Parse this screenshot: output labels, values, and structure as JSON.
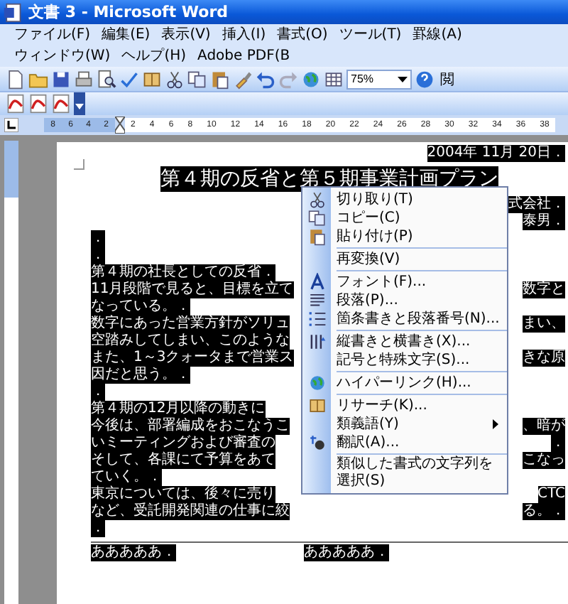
{
  "window": {
    "title": "文書 3 - Microsoft Word"
  },
  "menu_bar": [
    "ファイル(F)",
    "編集(E)",
    "表示(V)",
    "挿入(I)",
    "書式(O)",
    "ツール(T)",
    "罫線(A)",
    "ウィンドウ(W)",
    "ヘルプ(H)",
    "Adobe PDF(B"
  ],
  "toolbar": {
    "zoom": "75%",
    "reading_button": "閲"
  },
  "ruler": {
    "left_ticks": [
      "8",
      "6",
      "4",
      "2"
    ],
    "right_ticks": [
      "2",
      "4",
      "6",
      "8",
      "10",
      "12",
      "14",
      "16",
      "18",
      "20",
      "22",
      "24",
      "26",
      "28",
      "30",
      "32",
      "34",
      "36",
      "38"
    ]
  },
  "document": {
    "date": "2004年 11月 20日．",
    "title": "第４期の反省と第５期事業計画プラン",
    "lines": [
      {
        "right": "式会社．"
      },
      {
        "right": "泰男．"
      },
      {
        "left": "．"
      },
      {
        "left": "．"
      },
      {
        "left": "第４期の社長としての反省．"
      },
      {
        "left": "11月段階で見ると、目標を立て",
        "right": "数字と"
      },
      {
        "left": "なっている。．"
      },
      {
        "left": "数字にあった営業方針がソリュ",
        "right": "まい、"
      },
      {
        "left": "空踏みしてしまい、このような"
      },
      {
        "left": "また、1～3クォータまで営業ス",
        "right": "きな原"
      },
      {
        "left": "因だと思う。．"
      },
      {
        "left": "．"
      },
      {
        "left": "第４期の12月以降の動きに"
      },
      {
        "left": "今後は、部署編成をおこなうこ",
        "right": "、暗が"
      },
      {
        "left": "いミーティングおよび審査の",
        "right": "．"
      },
      {
        "left": "そして、各課にて予算をあて",
        "right": "こなっ"
      },
      {
        "left": "ていく。．"
      },
      {
        "left": "東京については、後々に売り",
        "right": "CTC"
      },
      {
        "left": "など、受託開発関連の仕事に絞",
        "right": "る。．"
      },
      {
        "left": "．"
      }
    ],
    "table_row": [
      "あああああ．",
      "あああああ．"
    ]
  },
  "context_menu": {
    "items": [
      {
        "kind": "item",
        "label": "切り取り(T)",
        "submenu": false
      },
      {
        "kind": "item",
        "label": "コピー(C)",
        "submenu": false
      },
      {
        "kind": "item",
        "label": "貼り付け(P)",
        "submenu": false
      },
      {
        "kind": "separator"
      },
      {
        "kind": "item",
        "label": "再変換(V)",
        "submenu": false
      },
      {
        "kind": "separator"
      },
      {
        "kind": "item",
        "label": "フォント(F)...",
        "submenu": false
      },
      {
        "kind": "item",
        "label": "段落(P)...",
        "submenu": false
      },
      {
        "kind": "item",
        "label": "箇条書きと段落番号(N)...",
        "submenu": false
      },
      {
        "kind": "separator"
      },
      {
        "kind": "item",
        "label": "縦書きと横書き(X)...",
        "submenu": false
      },
      {
        "kind": "item",
        "label": "記号と特殊文字(S)...",
        "submenu": false
      },
      {
        "kind": "separator"
      },
      {
        "kind": "item",
        "label": "ハイパーリンク(H)...",
        "submenu": false
      },
      {
        "kind": "separator"
      },
      {
        "kind": "item",
        "label": "リサーチ(K)...",
        "submenu": false
      },
      {
        "kind": "item",
        "label": "類義語(Y)",
        "submenu": true
      },
      {
        "kind": "item",
        "label": "翻訳(A)...",
        "submenu": false
      },
      {
        "kind": "separator"
      },
      {
        "kind": "item",
        "label": "類似した書式の文字列を選択(S)",
        "submenu": false
      }
    ]
  }
}
